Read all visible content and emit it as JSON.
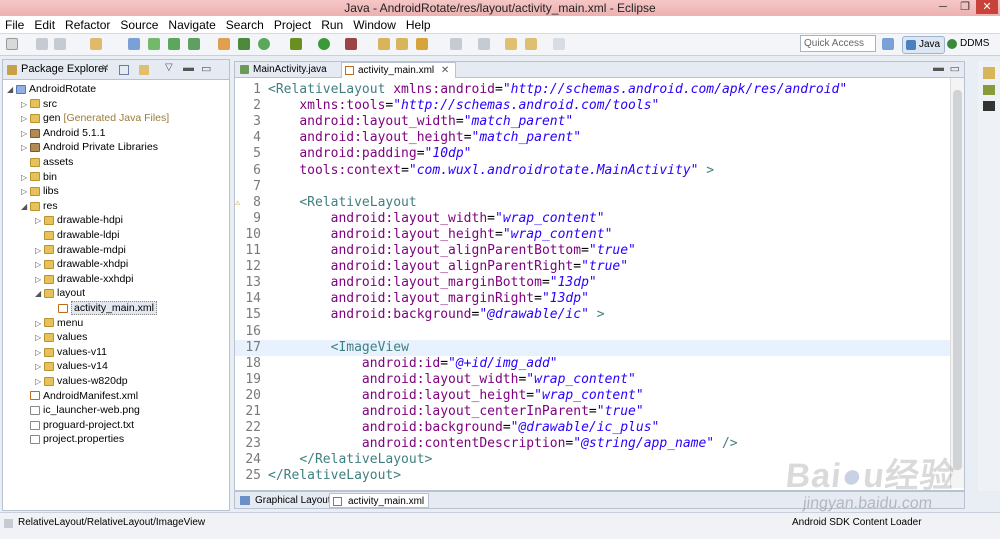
{
  "window": {
    "title": "Java - AndroidRotate/res/layout/activity_main.xml - Eclipse"
  },
  "menu": [
    "File",
    "Edit",
    "Refactor",
    "Source",
    "Navigate",
    "Search",
    "Project",
    "Run",
    "Window",
    "Help"
  ],
  "toolbar": {
    "quick_access_placeholder": "Quick Access",
    "perspectives": [
      "Java",
      "DDMS"
    ]
  },
  "package_explorer": {
    "title": "Package Explorer",
    "tree": [
      {
        "label": "AndroidRotate",
        "depth": 0,
        "icon": "project-icon",
        "expanded": true
      },
      {
        "label": "src",
        "depth": 1,
        "icon": "folder-icon"
      },
      {
        "label": "gen",
        "depth": 1,
        "icon": "folder-icon",
        "suffix": "[Generated Java Files]"
      },
      {
        "label": "Android 5.1.1",
        "depth": 1,
        "icon": "library-icon"
      },
      {
        "label": "Android Private Libraries",
        "depth": 1,
        "icon": "library-icon"
      },
      {
        "label": "assets",
        "depth": 1,
        "icon": "folder-icon",
        "noarrow": true
      },
      {
        "label": "bin",
        "depth": 1,
        "icon": "folder-icon"
      },
      {
        "label": "libs",
        "depth": 1,
        "icon": "folder-icon"
      },
      {
        "label": "res",
        "depth": 1,
        "icon": "folder-icon",
        "expanded": true
      },
      {
        "label": "drawable-hdpi",
        "depth": 2,
        "icon": "folder-icon"
      },
      {
        "label": "drawable-ldpi",
        "depth": 2,
        "icon": "folder-icon",
        "noarrow": true
      },
      {
        "label": "drawable-mdpi",
        "depth": 2,
        "icon": "folder-icon"
      },
      {
        "label": "drawable-xhdpi",
        "depth": 2,
        "icon": "folder-icon"
      },
      {
        "label": "drawable-xxhdpi",
        "depth": 2,
        "icon": "folder-icon"
      },
      {
        "label": "layout",
        "depth": 2,
        "icon": "folder-icon",
        "expanded": true
      },
      {
        "label": "activity_main.xml",
        "depth": 3,
        "icon": "xml-file-icon",
        "noarrow": true,
        "selected": true
      },
      {
        "label": "menu",
        "depth": 2,
        "icon": "folder-icon"
      },
      {
        "label": "values",
        "depth": 2,
        "icon": "folder-icon"
      },
      {
        "label": "values-v11",
        "depth": 2,
        "icon": "folder-icon"
      },
      {
        "label": "values-v14",
        "depth": 2,
        "icon": "folder-icon"
      },
      {
        "label": "values-w820dp",
        "depth": 2,
        "icon": "folder-icon"
      },
      {
        "label": "AndroidManifest.xml",
        "depth": 1,
        "icon": "xml-file-icon",
        "noarrow": true
      },
      {
        "label": "ic_launcher-web.png",
        "depth": 1,
        "icon": "image-file-icon",
        "noarrow": true
      },
      {
        "label": "proguard-project.txt",
        "depth": 1,
        "icon": "text-file-icon",
        "noarrow": true
      },
      {
        "label": "project.properties",
        "depth": 1,
        "icon": "text-file-icon",
        "noarrow": true
      }
    ]
  },
  "editor": {
    "tabs": [
      "MainActivity.java",
      "activity_main.xml"
    ],
    "active_tab": 1,
    "lines": [
      [
        {
          "t": "tag",
          "s": "<RelativeLayout "
        },
        {
          "t": "attr",
          "s": "xmlns:android"
        },
        {
          "t": "p",
          "s": "="
        },
        {
          "t": "val",
          "s": "\"http://schemas.android.com/apk/res/android\""
        }
      ],
      [
        {
          "t": "p",
          "s": "    "
        },
        {
          "t": "attr",
          "s": "xmlns:tools"
        },
        {
          "t": "p",
          "s": "="
        },
        {
          "t": "val",
          "s": "\"http://schemas.android.com/tools\""
        }
      ],
      [
        {
          "t": "p",
          "s": "    "
        },
        {
          "t": "attr",
          "s": "android:layout_width"
        },
        {
          "t": "p",
          "s": "="
        },
        {
          "t": "val",
          "s": "\"match_parent\""
        }
      ],
      [
        {
          "t": "p",
          "s": "    "
        },
        {
          "t": "attr",
          "s": "android:layout_height"
        },
        {
          "t": "p",
          "s": "="
        },
        {
          "t": "val",
          "s": "\"match_parent\""
        }
      ],
      [
        {
          "t": "p",
          "s": "    "
        },
        {
          "t": "attr",
          "s": "android:padding"
        },
        {
          "t": "p",
          "s": "="
        },
        {
          "t": "val",
          "s": "\"10dp\""
        }
      ],
      [
        {
          "t": "p",
          "s": "    "
        },
        {
          "t": "attr",
          "s": "tools:context"
        },
        {
          "t": "p",
          "s": "="
        },
        {
          "t": "val",
          "s": "\"com.wuxl.androidrotate.MainActivity\""
        },
        {
          "t": "tag",
          "s": " >"
        }
      ],
      [],
      [
        {
          "t": "p",
          "s": "    "
        },
        {
          "t": "tag",
          "s": "<RelativeLayout"
        }
      ],
      [
        {
          "t": "p",
          "s": "        "
        },
        {
          "t": "attr",
          "s": "android:layout_width"
        },
        {
          "t": "p",
          "s": "="
        },
        {
          "t": "val",
          "s": "\"wrap_content\""
        }
      ],
      [
        {
          "t": "p",
          "s": "        "
        },
        {
          "t": "attr",
          "s": "android:layout_height"
        },
        {
          "t": "p",
          "s": "="
        },
        {
          "t": "val",
          "s": "\"wrap_content\""
        }
      ],
      [
        {
          "t": "p",
          "s": "        "
        },
        {
          "t": "attr",
          "s": "android:layout_alignParentBottom"
        },
        {
          "t": "p",
          "s": "="
        },
        {
          "t": "val",
          "s": "\"true\""
        }
      ],
      [
        {
          "t": "p",
          "s": "        "
        },
        {
          "t": "attr",
          "s": "android:layout_alignParentRight"
        },
        {
          "t": "p",
          "s": "="
        },
        {
          "t": "val",
          "s": "\"true\""
        }
      ],
      [
        {
          "t": "p",
          "s": "        "
        },
        {
          "t": "attr",
          "s": "android:layout_marginBottom"
        },
        {
          "t": "p",
          "s": "="
        },
        {
          "t": "val",
          "s": "\"13dp\""
        }
      ],
      [
        {
          "t": "p",
          "s": "        "
        },
        {
          "t": "attr",
          "s": "android:layout_marginRight"
        },
        {
          "t": "p",
          "s": "="
        },
        {
          "t": "val",
          "s": "\"13dp\""
        }
      ],
      [
        {
          "t": "p",
          "s": "        "
        },
        {
          "t": "attr",
          "s": "android:background"
        },
        {
          "t": "p",
          "s": "="
        },
        {
          "t": "val",
          "s": "\"@drawable/ic\""
        },
        {
          "t": "tag",
          "s": " >"
        }
      ],
      [],
      [
        {
          "t": "p",
          "s": "        "
        },
        {
          "t": "tag",
          "s": "<ImageView"
        }
      ],
      [
        {
          "t": "p",
          "s": "            "
        },
        {
          "t": "attr",
          "s": "android:id"
        },
        {
          "t": "p",
          "s": "="
        },
        {
          "t": "val",
          "s": "\"@+id/img_add\""
        }
      ],
      [
        {
          "t": "p",
          "s": "            "
        },
        {
          "t": "attr",
          "s": "android:layout_width"
        },
        {
          "t": "p",
          "s": "="
        },
        {
          "t": "val",
          "s": "\"wrap_content\""
        }
      ],
      [
        {
          "t": "p",
          "s": "            "
        },
        {
          "t": "attr",
          "s": "android:layout_height"
        },
        {
          "t": "p",
          "s": "="
        },
        {
          "t": "val",
          "s": "\"wrap_content\""
        }
      ],
      [
        {
          "t": "p",
          "s": "            "
        },
        {
          "t": "attr",
          "s": "android:layout_centerInParent"
        },
        {
          "t": "p",
          "s": "="
        },
        {
          "t": "val",
          "s": "\"true\""
        }
      ],
      [
        {
          "t": "p",
          "s": "            "
        },
        {
          "t": "attr",
          "s": "android:background"
        },
        {
          "t": "p",
          "s": "="
        },
        {
          "t": "val",
          "s": "\"@drawable/ic_plus\""
        }
      ],
      [
        {
          "t": "p",
          "s": "            "
        },
        {
          "t": "attr",
          "s": "android:contentDescription"
        },
        {
          "t": "p",
          "s": "="
        },
        {
          "t": "val",
          "s": "\"@string/app_name\""
        },
        {
          "t": "tag",
          "s": " />"
        }
      ],
      [
        {
          "t": "p",
          "s": "    "
        },
        {
          "t": "tag",
          "s": "</RelativeLayout>"
        }
      ],
      [
        {
          "t": "tag",
          "s": "</RelativeLayout>"
        }
      ]
    ],
    "highlighted_line": 17,
    "warning_line": 8,
    "bottom_tabs": [
      "Graphical Layout",
      "activity_main.xml"
    ]
  },
  "status": {
    "left": "RelativeLayout/RelativeLayout/ImageView",
    "right": "Android SDK Content Loader"
  },
  "watermark": "Baidu经验 jingyan.baidu.com",
  "colors": {
    "tag": "#3f7f7f",
    "attr": "#7f007f",
    "value": "#2a00ff"
  }
}
